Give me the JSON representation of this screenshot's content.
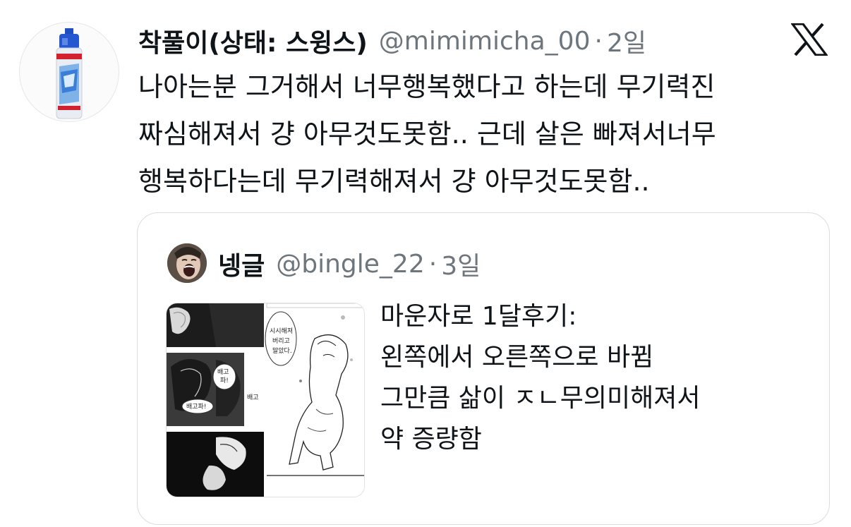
{
  "tweet": {
    "display_name": "착풀이(상태: 스윙스)",
    "handle": "@mimimicha_00",
    "separator": "·",
    "time": "2일",
    "text_lines": [
      "나아는분 그거해서 너무행복했다고 하는데 무기력진",
      "짜심해져서 걍 아무것도못함.. 근데 살은 빠져서너무",
      "행복하다는데 무기력해져서 걍 아무것도못함.."
    ],
    "avatar_icon": "glue-bottle-icon",
    "platform_icon": "x-logo-icon"
  },
  "quote": {
    "display_name": "넹글",
    "handle": "@bingle_22",
    "separator": "·",
    "time": "3일",
    "text_lines": [
      "마운자로 1달후기:",
      "왼쪽에서 오른쪽으로 바뀜",
      "그만큼 삶이 ㅈㄴ무의미해져서",
      "약 증량함"
    ],
    "media": {
      "left_panel_labels": [
        "배고",
        "파!",
        "배고파!",
        "배고"
      ],
      "right_panel_labels": [
        "시시해져",
        "버리고",
        "말았다."
      ]
    }
  },
  "colors": {
    "text_primary": "#0f1419",
    "text_secondary": "#6e767d",
    "border": "#d7dde2",
    "background": "#ffffff"
  }
}
